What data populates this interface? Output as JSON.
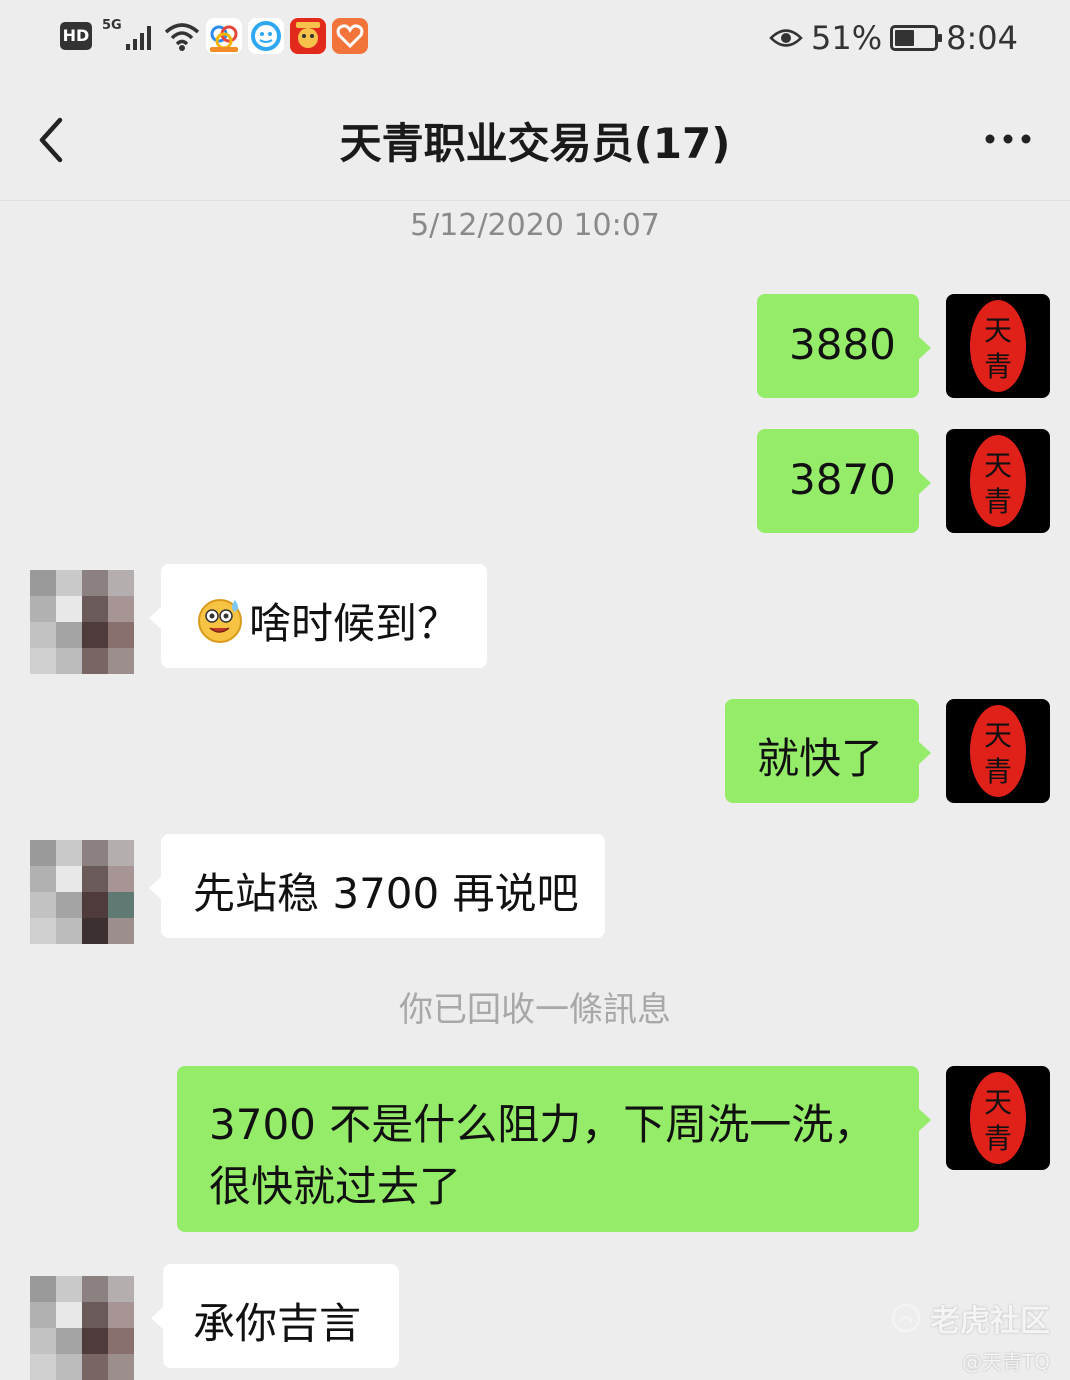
{
  "status_bar": {
    "hd_label": "HD",
    "network_label": "5G",
    "eye_icon": "eye-icon",
    "battery_percent_text": "51%",
    "battery_level": 0.51,
    "time": "8:04",
    "app_icons": [
      "baidu-cloud-icon",
      "qq-icon",
      "red-envelope-app-icon",
      "heart-app-icon"
    ]
  },
  "header": {
    "back_icon": "chevron-left-icon",
    "title": "天青职业交易员(17)",
    "more_icon": "more-dots-icon"
  },
  "chat": {
    "timestamp": "5/12/2020 10:07",
    "messages": [
      {
        "sender": "me",
        "text": "3880"
      },
      {
        "sender": "me",
        "text": "3870"
      },
      {
        "sender": "them",
        "emoji": "sweat-laugh-emoji",
        "text": "啥时候到？"
      },
      {
        "sender": "me",
        "text": "就快了"
      },
      {
        "sender": "them",
        "text": "先站稳 3700 再说吧"
      },
      {
        "sender": "me",
        "text_line1": "3700 不是什么阻力，下周洗一洗，",
        "text_line2": "很快就过去了"
      },
      {
        "sender": "them",
        "text": "承你吉言"
      }
    ],
    "system_notice": "你已回收一條訊息"
  },
  "avatar_me_seal_text": "天青",
  "watermark": {
    "main": "老虎社区",
    "sub": "@天青TQ"
  },
  "colors": {
    "background": "#ededed",
    "bubble_me": "#95ec69",
    "bubble_them": "#ffffff",
    "seal_red": "#e0211a"
  }
}
